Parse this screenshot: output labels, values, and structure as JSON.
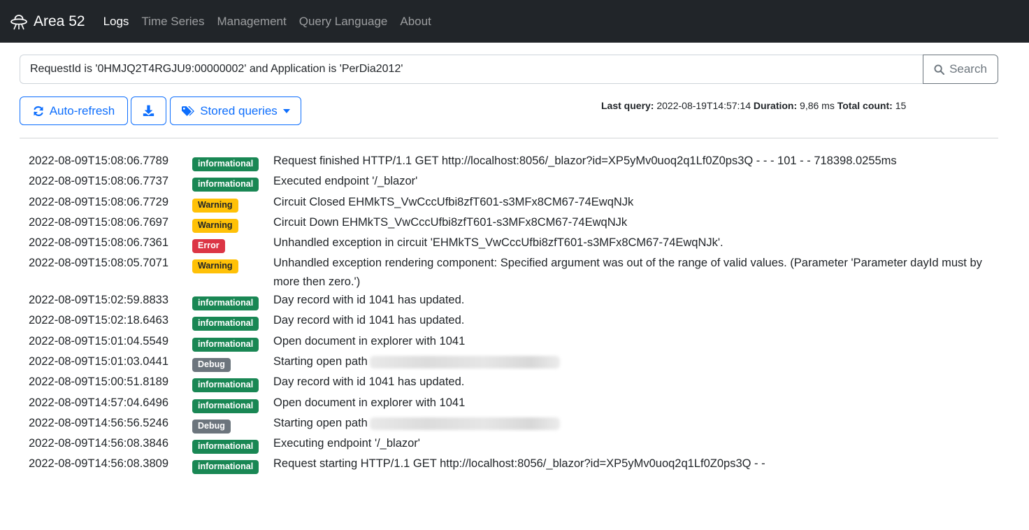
{
  "navbar": {
    "brand": "Area 52",
    "brand_icon": "ufo-icon",
    "links": [
      {
        "label": "Logs",
        "active": true
      },
      {
        "label": "Time Series",
        "active": false
      },
      {
        "label": "Management",
        "active": false
      },
      {
        "label": "Query Language",
        "active": false
      },
      {
        "label": "About",
        "active": false
      }
    ]
  },
  "search": {
    "query": "RequestId is '0HMJQ2T4RGJU9:00000002' and Application is 'PerDia2012'",
    "button_label": "Search",
    "button_icon": "search-icon"
  },
  "toolbar": {
    "auto_refresh_label": "Auto-refresh",
    "auto_refresh_icon": "refresh-icon",
    "download_icon": "download-icon",
    "stored_queries_label": "Stored queries",
    "stored_queries_icon": "tags-icon"
  },
  "status": {
    "last_query_label": "Last query:",
    "last_query_value": "2022-08-19T14:57:14",
    "duration_label": "Duration:",
    "duration_value": "9,86 ms",
    "total_count_label": "Total count:",
    "total_count_value": "15"
  },
  "colors": {
    "navbar_bg": "#212529",
    "primary": "#0d6efd",
    "informational": "#198754",
    "warning": "#ffc107",
    "error": "#dc3545",
    "debug": "#6c757d"
  },
  "logs": [
    {
      "timestamp": "2022-08-09T15:08:06.7789",
      "level": "informational",
      "message": "Request finished HTTP/1.1 GET http://localhost:8056/_blazor?id=XP5yMv0uoq2q1Lf0Z0ps3Q - - - 101 - - 718398.0255ms"
    },
    {
      "timestamp": "2022-08-09T15:08:06.7737",
      "level": "informational",
      "message": "Executed endpoint '/_blazor'"
    },
    {
      "timestamp": "2022-08-09T15:08:06.7729",
      "level": "Warning",
      "message": "Circuit Closed EHMkTS_VwCccUfbi8zfT601-s3MFx8CM67-74EwqNJk"
    },
    {
      "timestamp": "2022-08-09T15:08:06.7697",
      "level": "Warning",
      "message": "Circuit Down EHMkTS_VwCccUfbi8zfT601-s3MFx8CM67-74EwqNJk"
    },
    {
      "timestamp": "2022-08-09T15:08:06.7361",
      "level": "Error",
      "message": "Unhandled exception in circuit 'EHMkTS_VwCccUfbi8zfT601-s3MFx8CM67-74EwqNJk'."
    },
    {
      "timestamp": "2022-08-09T15:08:05.7071",
      "level": "Warning",
      "message": "Unhandled exception rendering component: Specified argument was out of the range of valid values. (Parameter 'Parameter dayId must by more then zero.')"
    },
    {
      "timestamp": "2022-08-09T15:02:59.8833",
      "level": "informational",
      "message": "Day record with id 1041 has updated."
    },
    {
      "timestamp": "2022-08-09T15:02:18.6463",
      "level": "informational",
      "message": "Day record with id 1041 has updated."
    },
    {
      "timestamp": "2022-08-09T15:01:04.5549",
      "level": "informational",
      "message": "Open document in explorer with 1041"
    },
    {
      "timestamp": "2022-08-09T15:01:03.0441",
      "level": "Debug",
      "message": "Starting open path",
      "redacted": true
    },
    {
      "timestamp": "2022-08-09T15:00:51.8189",
      "level": "informational",
      "message": "Day record with id 1041 has updated."
    },
    {
      "timestamp": "2022-08-09T14:57:04.6496",
      "level": "informational",
      "message": "Open document in explorer with 1041"
    },
    {
      "timestamp": "2022-08-09T14:56:56.5246",
      "level": "Debug",
      "message": "Starting open path",
      "redacted": true
    },
    {
      "timestamp": "2022-08-09T14:56:08.3846",
      "level": "informational",
      "message": "Executing endpoint '/_blazor'"
    },
    {
      "timestamp": "2022-08-09T14:56:08.3809",
      "level": "informational",
      "message": "Request starting HTTP/1.1 GET http://localhost:8056/_blazor?id=XP5yMv0uoq2q1Lf0Z0ps3Q - -"
    }
  ]
}
